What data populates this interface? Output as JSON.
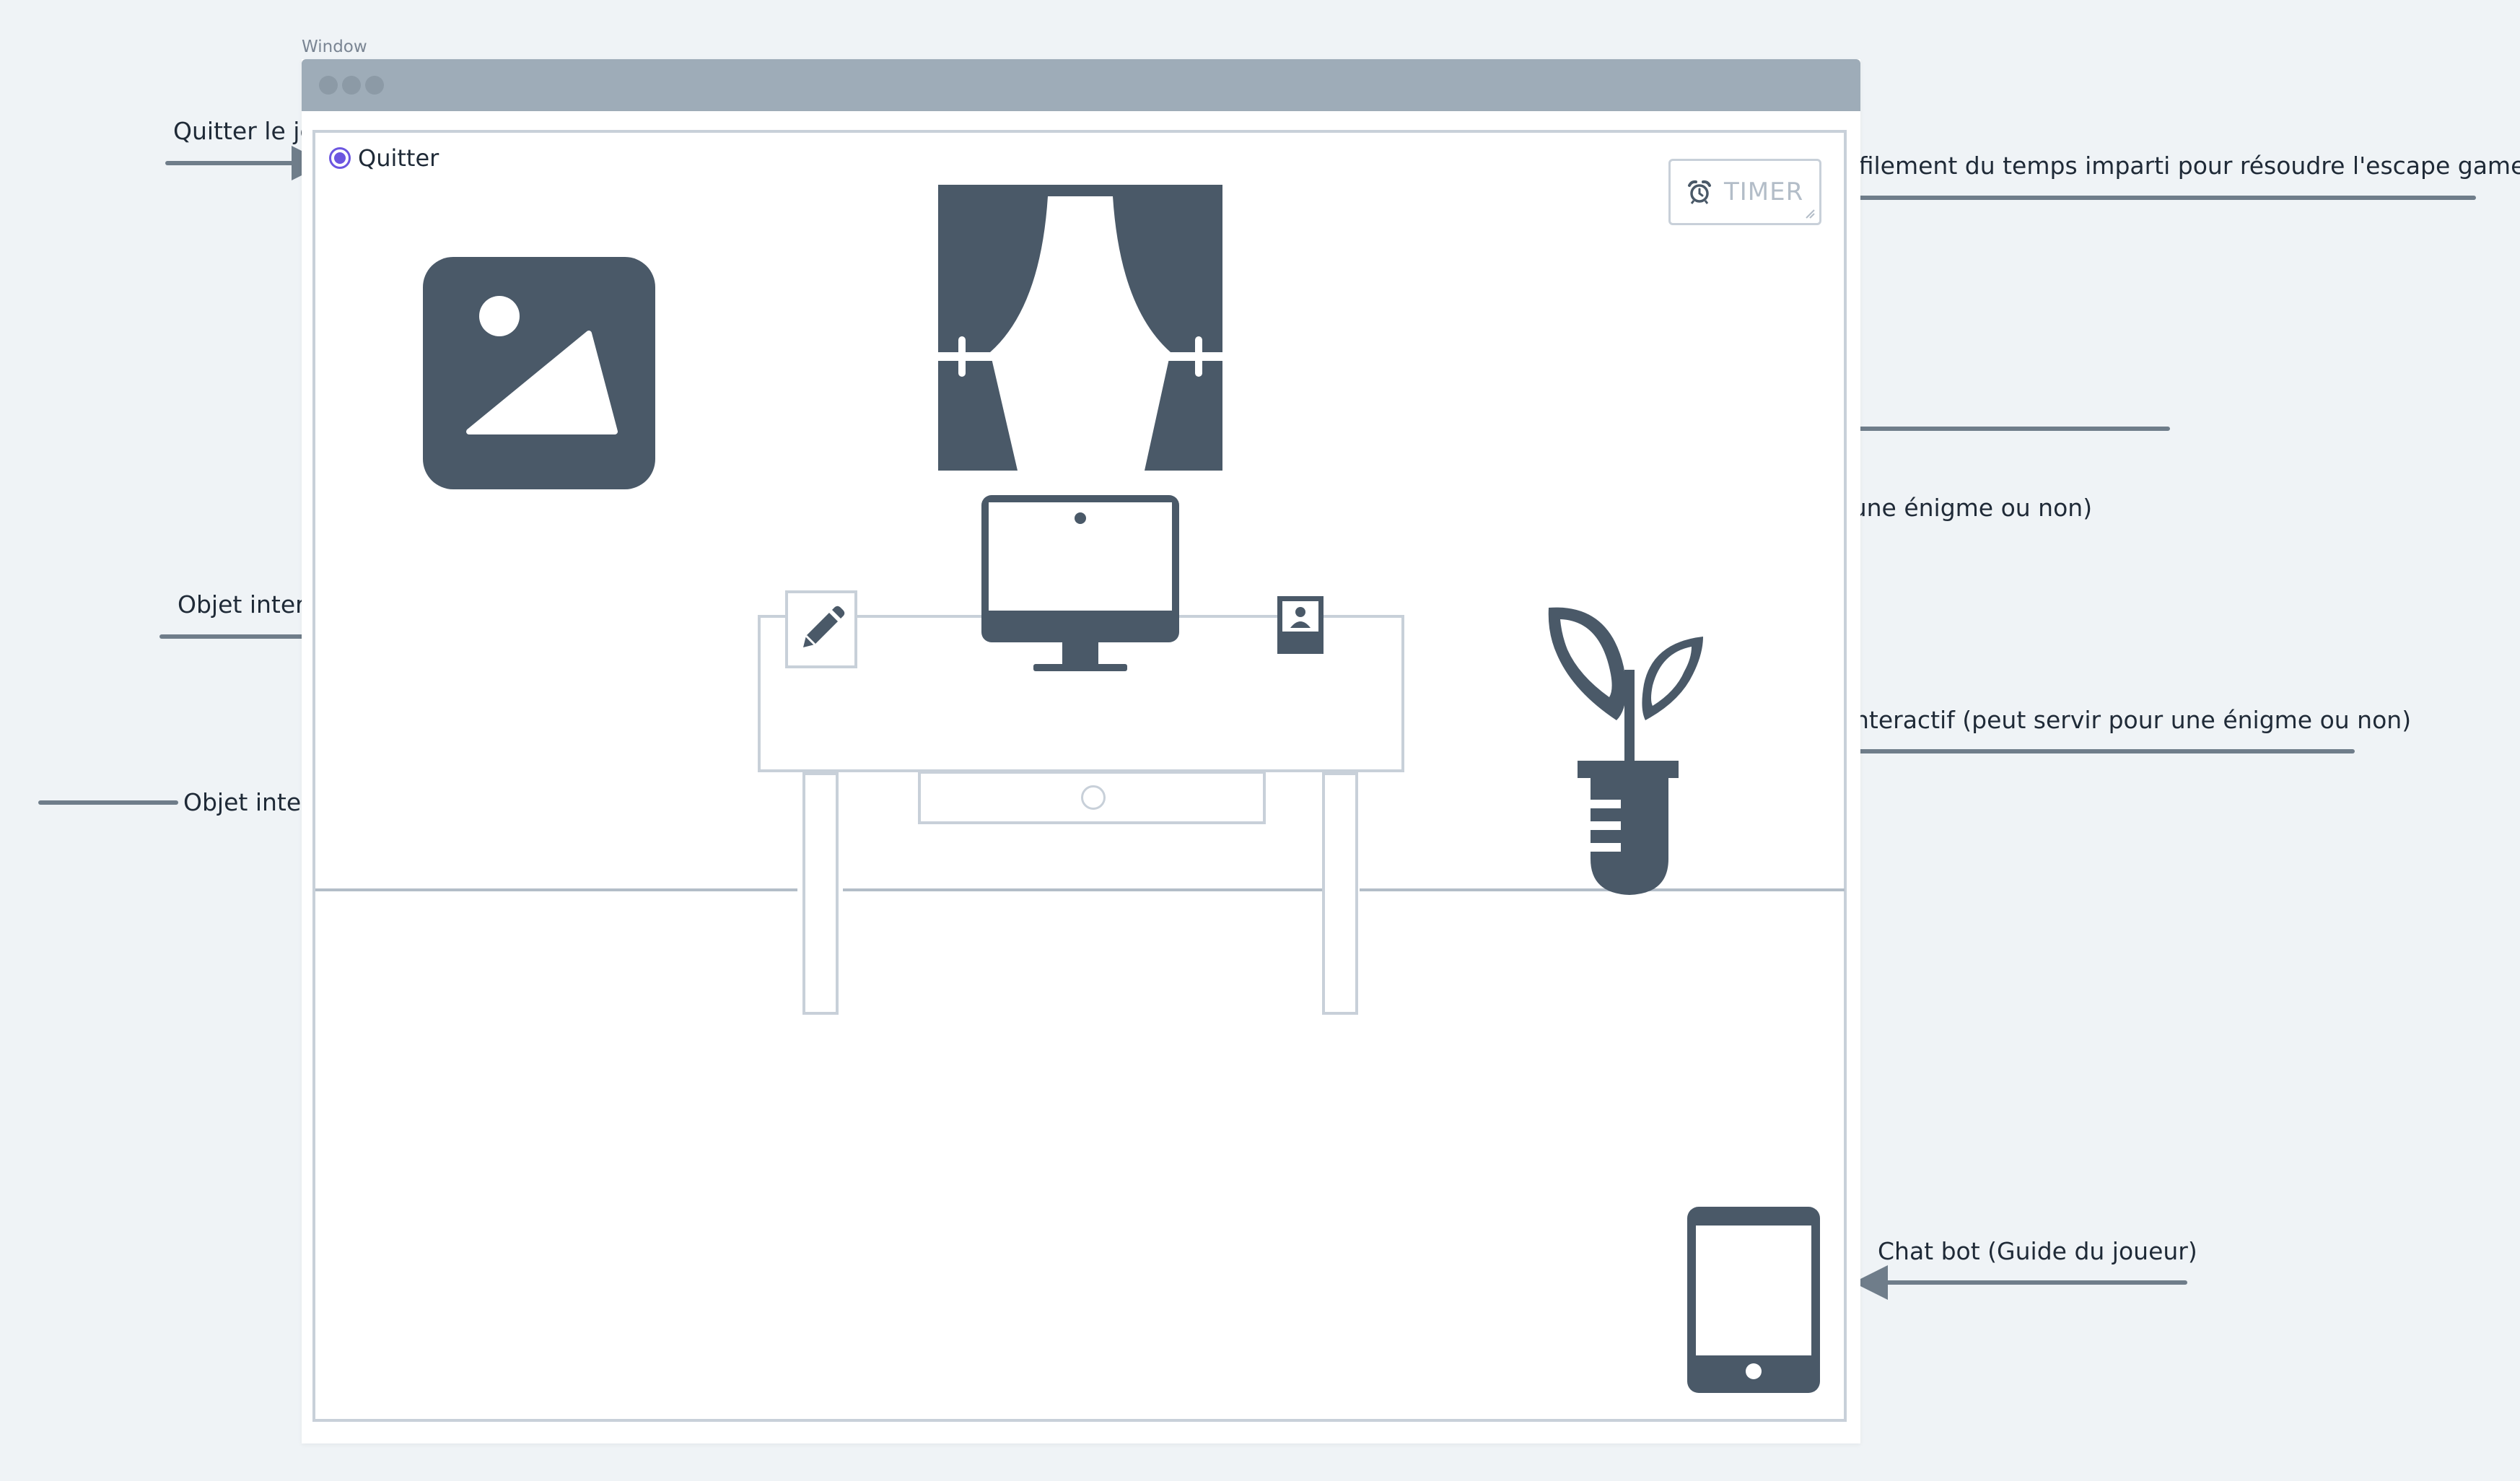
{
  "window": {
    "label": "Window"
  },
  "quit": {
    "label": "Quitter"
  },
  "timer": {
    "placeholder": "TIMER"
  },
  "annotations": {
    "quit": "Quitter le jeu",
    "timer": "Défilement du temps imparti pour résoudre l'escape game",
    "frame_object": "Objet interactif (peut servir pour une énigme ou non)",
    "pencil": "Objet interactif (peut servir pour une énigme ou non)",
    "drawer": "Objet interactif (peut servir pour une énigme ou non)",
    "plant": "Objet interactif (peut servir pour une énigme ou non)",
    "chatbot": "Chat bot (Guide du joueur)"
  },
  "icons": {
    "painting": "image-icon",
    "window": "curtains-icon",
    "computer": "desktop-monitor-icon",
    "frame": "portrait-frame-icon",
    "pencil": "pencil-icon",
    "plant": "plant-icon",
    "tablet": "tablet-icon",
    "timer": "alarm-clock-icon"
  },
  "colors": {
    "background": "#eff3f6",
    "titlebar": "#9eacb8",
    "icon": "#4a5968",
    "outline": "#c8d0d9",
    "arrow": "#6f7d8a",
    "radio": "#6c56e0"
  }
}
